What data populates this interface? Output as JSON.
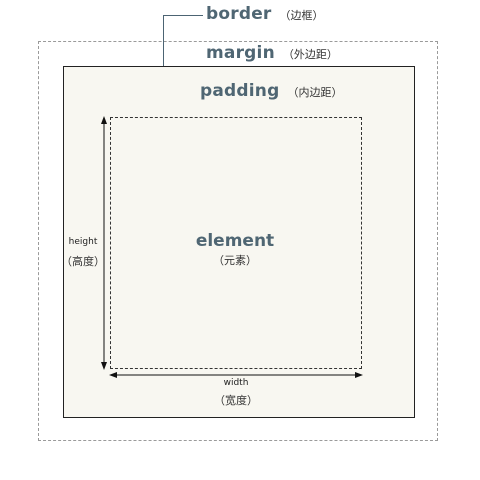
{
  "diagram": {
    "border": {
      "label": "border",
      "note": "（边框）"
    },
    "margin": {
      "label": "margin",
      "note": "（外边距）"
    },
    "padding": {
      "label": "padding",
      "note": "（内边距）"
    },
    "element": {
      "label": "element",
      "note": "（元素）"
    },
    "height": {
      "label": "height",
      "note": "（高度）"
    },
    "width": {
      "label": "width",
      "note": "（宽度）"
    },
    "colors": {
      "label_accent": "#4f6673",
      "box_fill": "#f8f7f1",
      "margin_dash": "#9a9a9a",
      "border_line": "#222222"
    }
  }
}
